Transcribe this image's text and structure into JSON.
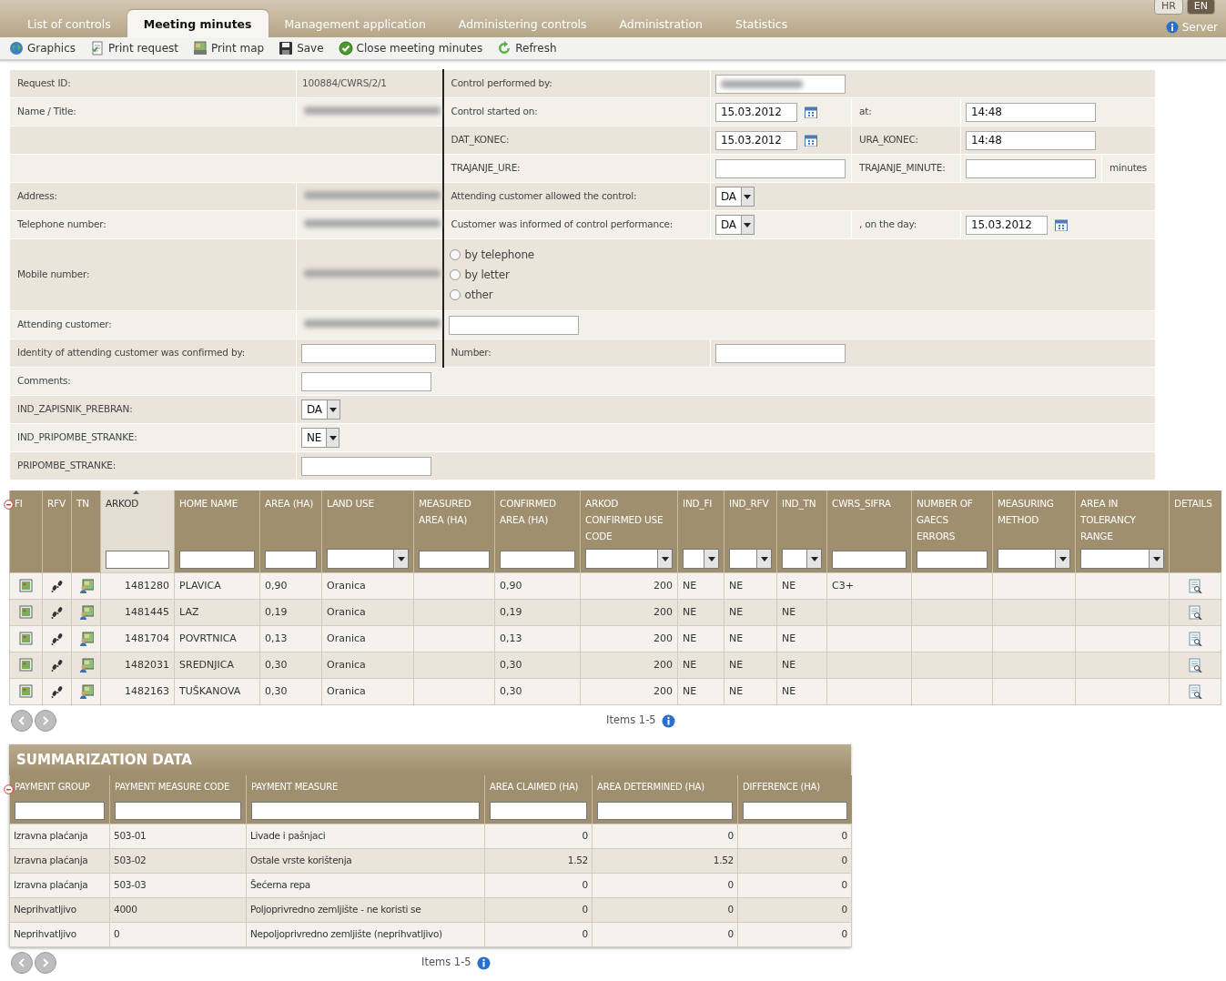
{
  "top_tabs": [
    {
      "label": "List of controls",
      "selected": false
    },
    {
      "label": "Meeting minutes",
      "selected": true
    },
    {
      "label": "Management application",
      "selected": false
    },
    {
      "label": "Administering controls",
      "selected": false
    },
    {
      "label": "Administration",
      "selected": false
    },
    {
      "label": "Statistics",
      "selected": false
    }
  ],
  "languages": [
    {
      "label": "HR",
      "selected": false
    },
    {
      "label": "EN",
      "selected": true
    }
  ],
  "server": {
    "label": "Server"
  },
  "toolbar": [
    {
      "label": "Graphics"
    },
    {
      "label": "Print request"
    },
    {
      "label": "Print map"
    },
    {
      "label": "Save"
    },
    {
      "label": "Close meeting minutes"
    },
    {
      "label": "Refresh"
    }
  ],
  "form": [
    {
      "left": [
        {
          "kind": "label",
          "text": "Request ID:"
        },
        {
          "kind": "text",
          "text": "100884/CWRS/2/1"
        }
      ],
      "right": [
        {
          "kind": "label",
          "text": "Control performed by:"
        },
        {
          "kind": "field",
          "blurred": true
        }
      ]
    },
    {
      "left": [
        {
          "kind": "label",
          "text": "Name / Title:"
        },
        {
          "kind": "blurred"
        }
      ],
      "right": [
        {
          "kind": "label",
          "text": "Control started on:"
        },
        {
          "kind": "date",
          "value": "15.03.2012"
        },
        {
          "kind": "label",
          "text": "at:"
        },
        {
          "kind": "field",
          "value": "14:48"
        }
      ]
    },
    {
      "right": [
        {
          "kind": "label",
          "text": "DAT_KONEC:"
        },
        {
          "kind": "date",
          "value": "15.03.2012"
        },
        {
          "kind": "label",
          "text": "URA_KONEC:"
        },
        {
          "kind": "field",
          "value": "14:48"
        }
      ]
    },
    {
      "right": [
        {
          "kind": "label",
          "text": "TRAJANJE_URE:"
        },
        {
          "kind": "field"
        },
        {
          "kind": "label",
          "text": "TRAJANJE_MINUTE:"
        },
        {
          "kind": "field"
        },
        {
          "kind": "label",
          "text": "minutes"
        }
      ]
    },
    {
      "left": [
        {
          "kind": "label",
          "text": "Address:"
        },
        {
          "kind": "blurred"
        }
      ],
      "right": [
        {
          "kind": "label",
          "text": "Attending customer allowed the control:"
        },
        {
          "kind": "select",
          "value": "DA"
        }
      ]
    },
    {
      "left": [
        {
          "kind": "label",
          "text": "Telephone number:"
        },
        {
          "kind": "blurred"
        }
      ],
      "right": [
        {
          "kind": "label",
          "text": "Customer was informed of control performance:"
        },
        {
          "kind": "select",
          "value": "DA"
        },
        {
          "kind": "label",
          "text": ", on the day:"
        },
        {
          "kind": "date",
          "value": "15.03.2012"
        }
      ]
    },
    {
      "left": [
        {
          "kind": "label",
          "text": "Mobile number:"
        },
        {
          "kind": "blurred"
        }
      ],
      "right": [
        {
          "kind": "radios",
          "options": [
            {
              "label": "by telephone",
              "selected": false
            },
            {
              "label": "by letter",
              "selected": false
            },
            {
              "label": "other",
              "selected": false
            }
          ]
        }
      ]
    },
    {
      "left": [
        {
          "kind": "label",
          "text": "Attending customer:"
        },
        {
          "kind": "blurred"
        }
      ],
      "right": [
        {
          "kind": "field"
        }
      ]
    },
    {
      "left": [
        {
          "kind": "label",
          "text": "Identity of attending customer was confirmed by:"
        },
        {
          "kind": "field"
        }
      ],
      "right": [
        {
          "kind": "label",
          "text": "Number:"
        },
        {
          "kind": "field"
        }
      ]
    },
    {
      "left": [
        {
          "kind": "label",
          "text": "Comments:"
        },
        {
          "kind": "field"
        }
      ]
    },
    {
      "left": [
        {
          "kind": "label",
          "text": "IND_ZAPISNIK_PREBRAN:"
        },
        {
          "kind": "select",
          "value": "DA"
        }
      ]
    },
    {
      "left": [
        {
          "kind": "label",
          "text": "IND_PRIPOMBE_STRANKE:"
        },
        {
          "kind": "select",
          "value": "NE"
        }
      ]
    },
    {
      "left": [
        {
          "kind": "label",
          "text": "PRIPOMBE_STRANKE:"
        },
        {
          "kind": "field"
        }
      ]
    }
  ],
  "parcels": {
    "columns": [
      {
        "label": "FI",
        "kind": "image",
        "sorted": false
      },
      {
        "label": "RFV",
        "kind": "steps",
        "sorted": false
      },
      {
        "label": "TN",
        "kind": "person",
        "sorted": false
      },
      {
        "label": "ARKOD",
        "kind": "number",
        "sorted": true
      },
      {
        "label": "HOME NAME",
        "kind": "text",
        "sorted": false
      },
      {
        "label": "AREA (HA)",
        "kind": "text",
        "sorted": false
      },
      {
        "label": "LAND USE",
        "kind": "choice",
        "sorted": false
      },
      {
        "label": "MEASURED AREA (HA)",
        "kind": "text",
        "sorted": false
      },
      {
        "label": "CONFIRMED AREA (HA)",
        "kind": "text",
        "sorted": false
      },
      {
        "label": "ARKOD CONFIRMED USE CODE",
        "kind": "code",
        "sorted": false
      },
      {
        "label": "IND_FI",
        "kind": "choice",
        "sorted": false
      },
      {
        "label": "IND_RFV",
        "kind": "choice",
        "sorted": false
      },
      {
        "label": "IND_TN",
        "kind": "choice",
        "sorted": false
      },
      {
        "label": "CWRS_SIFRA",
        "kind": "text",
        "sorted": false
      },
      {
        "label": "NUMBER OF GAECS ERRORS",
        "kind": "text",
        "sorted": false
      },
      {
        "label": "MEASURING METHOD",
        "kind": "choice",
        "sorted": false
      },
      {
        "label": "AREA IN TOLERANCY RANGE",
        "kind": "choice",
        "sorted": false
      },
      {
        "label": "DETAILS",
        "kind": "details",
        "sorted": false
      }
    ],
    "rows": [
      {
        "cells": [
          null,
          null,
          null,
          "1481280",
          "PLAVICA",
          "0,90",
          "Oranica",
          null,
          "0,90",
          "200",
          "NE",
          "NE",
          "NE",
          "C3+",
          null,
          null,
          null,
          null
        ]
      },
      {
        "cells": [
          null,
          null,
          null,
          "1481445",
          "LAZ",
          "0,19",
          "Oranica",
          null,
          "0,19",
          "200",
          "NE",
          "NE",
          "NE",
          null,
          null,
          null,
          null,
          null
        ]
      },
      {
        "cells": [
          null,
          null,
          null,
          "1481704",
          "POVRTNICA",
          "0,13",
          "Oranica",
          null,
          "0,13",
          "200",
          "NE",
          "NE",
          "NE",
          null,
          null,
          null,
          null,
          null
        ]
      },
      {
        "cells": [
          null,
          null,
          null,
          "1482031",
          "SREDNJICA",
          "0,30",
          "Oranica",
          null,
          "0,30",
          "200",
          "NE",
          "NE",
          "NE",
          null,
          null,
          null,
          null,
          null
        ]
      },
      {
        "cells": [
          null,
          null,
          null,
          "1482163",
          "TUŠKANOVA",
          "0,30",
          "Oranica",
          null,
          "0,30",
          "200",
          "NE",
          "NE",
          "NE",
          null,
          null,
          null,
          null,
          null
        ]
      }
    ],
    "pager": {
      "label": "Items 1-5"
    }
  },
  "summary": {
    "title": "SUMMARIZATION DATA",
    "columns": [
      {
        "label": "PAYMENT GROUP",
        "kind": "text",
        "sorted": false
      },
      {
        "label": "PAYMENT MEASURE CODE",
        "kind": "text",
        "sorted": false
      },
      {
        "label": "PAYMENT MEASURE",
        "kind": "text",
        "sorted": false
      },
      {
        "label": "AREA CLAIMED (HA)",
        "kind": "number",
        "sorted": false
      },
      {
        "label": "AREA DETERMINED (HA)",
        "kind": "number",
        "sorted": false
      },
      {
        "label": "DIFFERENCE (HA)",
        "kind": "number",
        "sorted": false
      }
    ],
    "rows": [
      {
        "cells": [
          "Izravna plaćanja",
          "503-01",
          "Livade i pašnjaci",
          "0",
          "0",
          "0"
        ]
      },
      {
        "cells": [
          "Izravna plaćanja",
          "503-02",
          "Ostale vrste korištenja",
          "1.52",
          "1.52",
          "0"
        ]
      },
      {
        "cells": [
          "Izravna plaćanja",
          "503-03",
          "Šećerna repa",
          "0",
          "0",
          "0"
        ]
      },
      {
        "cells": [
          "Neprihvatljivo",
          "4000",
          "Poljoprivredno zemljište - ne koristi se",
          "0",
          "0",
          "0"
        ]
      },
      {
        "cells": [
          "Neprihvatljivo",
          "0",
          "Nepoljoprivredno zemljište (neprihvatljivo)",
          "0",
          "0",
          "0"
        ]
      }
    ],
    "pager": {
      "label": "Items 1-5"
    }
  }
}
